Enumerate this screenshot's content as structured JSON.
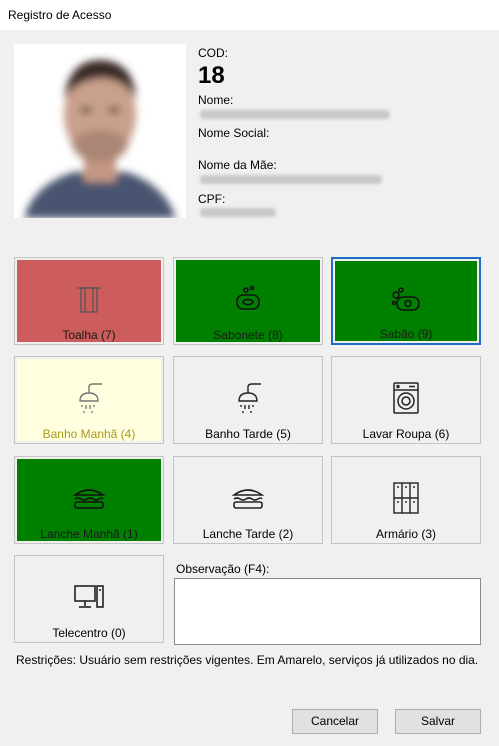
{
  "window": {
    "title": "Registro de Acesso"
  },
  "person": {
    "cod_label": "COD:",
    "cod_value": "18",
    "nome_label": "Nome:",
    "nome_social_label": "Nome Social:",
    "nome_mae_label": "Nome da Mãe:",
    "cpf_label": "CPF:"
  },
  "services": [
    {
      "label": "Toalha (7)",
      "icon": "towel-icon",
      "status": "red"
    },
    {
      "label": "Sabonete (8)",
      "icon": "soap-icon",
      "status": "green"
    },
    {
      "label": "Sabão (9)",
      "icon": "soap-bubbles-icon",
      "status": "green"
    },
    {
      "label": "Banho Manhã (4)",
      "icon": "shower-icon",
      "status": "yellow"
    },
    {
      "label": "Banho Tarde (5)",
      "icon": "shower-icon",
      "status": "plain"
    },
    {
      "label": "Lavar Roupa (6)",
      "icon": "washing-machine-icon",
      "status": "plain"
    },
    {
      "label": "Lanche Manhã (1)",
      "icon": "sandwich-icon",
      "status": "green"
    },
    {
      "label": "Lanche Tarde (2)",
      "icon": "sandwich-icon",
      "status": "plain"
    },
    {
      "label": "Armário (3)",
      "icon": "locker-icon",
      "status": "plain"
    },
    {
      "label": "Telecentro (0)",
      "icon": "computer-icon",
      "status": "plain"
    }
  ],
  "observacao": {
    "label": "Observação (F4):",
    "value": ""
  },
  "restricoes": {
    "text": "Restrições:  Usuário sem restrições vigentes. Em Amarelo, serviços já utilizados no dia."
  },
  "buttons": {
    "cancel": "Cancelar",
    "save": "Salvar"
  },
  "colors": {
    "red": "#cd5c5c",
    "green": "#008000",
    "yellow": "#ffffdf",
    "selected_border": "#1e6ec8"
  }
}
